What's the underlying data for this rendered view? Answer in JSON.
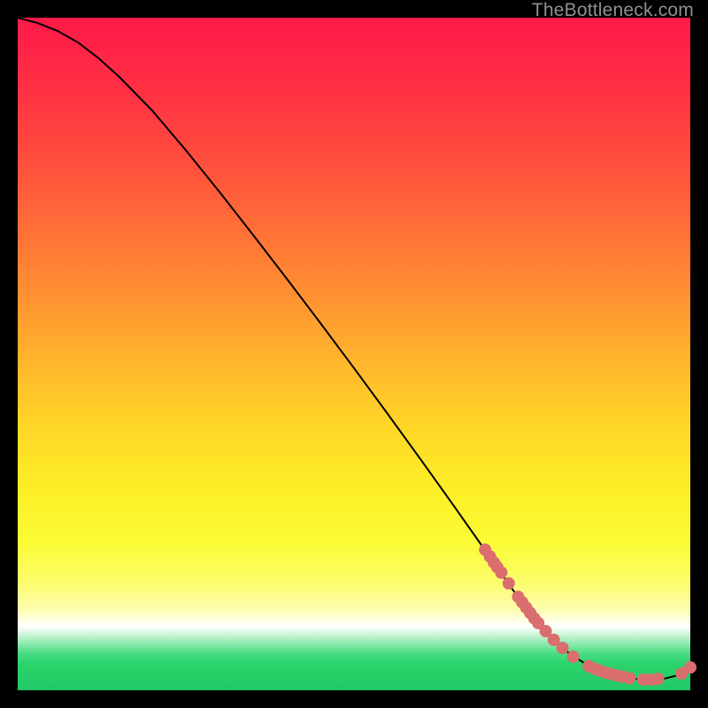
{
  "watermark": "TheBottleneck.com",
  "colors": {
    "curve": "#000000",
    "point_fill": "#da6e6e",
    "point_stroke": "#b84f4f",
    "gradient_stops": [
      {
        "offset": 0.0,
        "color": "#ff1a49"
      },
      {
        "offset": 0.1,
        "color": "#ff2f44"
      },
      {
        "offset": 0.2,
        "color": "#ff4a3e"
      },
      {
        "offset": 0.3,
        "color": "#ff6a38"
      },
      {
        "offset": 0.4,
        "color": "#ff8c32"
      },
      {
        "offset": 0.5,
        "color": "#ffb12d"
      },
      {
        "offset": 0.6,
        "color": "#ffd427"
      },
      {
        "offset": 0.7,
        "color": "#fcee27"
      },
      {
        "offset": 0.78,
        "color": "#fbfb36"
      },
      {
        "offset": 0.84,
        "color": "#fcfc6c"
      },
      {
        "offset": 0.88,
        "color": "#fdfdb0"
      },
      {
        "offset": 0.905,
        "color": "#ffffff"
      },
      {
        "offset": 0.915,
        "color": "#d7f7e0"
      },
      {
        "offset": 0.93,
        "color": "#8eebb0"
      },
      {
        "offset": 0.945,
        "color": "#49dd84"
      },
      {
        "offset": 0.96,
        "color": "#2cd46d"
      },
      {
        "offset": 1.0,
        "color": "#22c864"
      }
    ]
  },
  "chart_data": {
    "type": "line",
    "title": "",
    "xlabel": "",
    "ylabel": "",
    "xlim": [
      0,
      100
    ],
    "ylim": [
      0,
      100
    ],
    "series": [
      {
        "name": "curve",
        "x": [
          0,
          3,
          6,
          9,
          12,
          15,
          20,
          25,
          30,
          35,
          40,
          45,
          50,
          55,
          60,
          65,
          70,
          72,
          74,
          76,
          78,
          80,
          82,
          84,
          86,
          88,
          90,
          92,
          94,
          96,
          98,
          100
        ],
        "y": [
          100,
          99.2,
          98.0,
          96.3,
          94.0,
          91.3,
          86.2,
          80.3,
          74.1,
          67.7,
          61.2,
          54.6,
          47.9,
          41.1,
          34.2,
          27.2,
          20.1,
          17.2,
          14.4,
          11.7,
          9.3,
          7.2,
          5.5,
          4.2,
          3.2,
          2.5,
          2.0,
          1.7,
          1.6,
          1.7,
          2.2,
          3.4
        ]
      }
    ],
    "points": [
      {
        "x": 69.5,
        "y": 20.9
      },
      {
        "x": 70.2,
        "y": 19.9
      },
      {
        "x": 70.8,
        "y": 19.0
      },
      {
        "x": 71.3,
        "y": 18.3
      },
      {
        "x": 71.9,
        "y": 17.5
      },
      {
        "x": 73.0,
        "y": 15.9
      },
      {
        "x": 74.4,
        "y": 13.9
      },
      {
        "x": 75.0,
        "y": 13.1
      },
      {
        "x": 75.6,
        "y": 12.3
      },
      {
        "x": 76.2,
        "y": 11.5
      },
      {
        "x": 76.8,
        "y": 10.7
      },
      {
        "x": 77.4,
        "y": 10.0
      },
      {
        "x": 78.5,
        "y": 8.8
      },
      {
        "x": 79.7,
        "y": 7.5
      },
      {
        "x": 81.0,
        "y": 6.3
      },
      {
        "x": 82.6,
        "y": 5.0
      },
      {
        "x": 84.9,
        "y": 3.6
      },
      {
        "x": 85.8,
        "y": 3.2
      },
      {
        "x": 86.6,
        "y": 2.9
      },
      {
        "x": 87.5,
        "y": 2.6
      },
      {
        "x": 88.3,
        "y": 2.4
      },
      {
        "x": 89.1,
        "y": 2.2
      },
      {
        "x": 90.0,
        "y": 2.0
      },
      {
        "x": 91.0,
        "y": 1.8
      },
      {
        "x": 93.0,
        "y": 1.6
      },
      {
        "x": 94.2,
        "y": 1.6
      },
      {
        "x": 95.2,
        "y": 1.7
      },
      {
        "x": 98.7,
        "y": 2.5
      },
      {
        "x": 100.0,
        "y": 3.4
      }
    ],
    "point_radius_px": 7
  }
}
